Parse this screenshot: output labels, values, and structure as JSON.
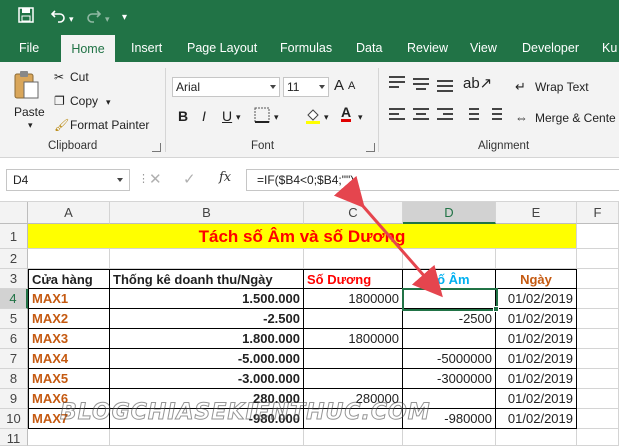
{
  "colors": {
    "ribbon_green": "#217346",
    "title_fill": "#ffff00",
    "title_text": "#ff0000",
    "store_text": "#c55a11",
    "am_header": "#00b0f0",
    "arrow": "#e5454e"
  },
  "tabs": [
    "File",
    "Home",
    "Insert",
    "Page Layout",
    "Formulas",
    "Data",
    "Review",
    "View",
    "Developer",
    "Ku"
  ],
  "active_tab": "Home",
  "clipboard": {
    "paste": "Paste",
    "cut": "Cut",
    "copy": "Copy",
    "format_painter": "Format Painter",
    "label": "Clipboard"
  },
  "font": {
    "name": "Arial",
    "size": "11",
    "bold": "B",
    "italic": "I",
    "underline": "U",
    "label": "Font",
    "grow": "A",
    "shrink": "A"
  },
  "alignment": {
    "wrap_text": "Wrap Text",
    "merge": "Merge & Cente",
    "label": "Alignment"
  },
  "formula_bar": {
    "name_box": "D4",
    "fx": "fx",
    "formula": "=IF($B4<0;$B4;\"\")"
  },
  "columns": [
    "A",
    "B",
    "C",
    "D",
    "E",
    "F"
  ],
  "rows": [
    "1",
    "2",
    "3",
    "4",
    "5",
    "6",
    "7",
    "8",
    "9",
    "10",
    "11"
  ],
  "sheet": {
    "title": "Tách số Âm và số Dương",
    "headers": {
      "store": "Cửa hàng",
      "stats": "Thống kê doanh thu/Ngày",
      "positive": "Số Dương",
      "negative": "Số Âm",
      "date": "Ngày"
    },
    "data": [
      {
        "store": "MAX1",
        "value": "1.500.000",
        "positive": "1800000",
        "negative": "",
        "date": "01/02/2019"
      },
      {
        "store": "MAX2",
        "value": "-2.500",
        "positive": "",
        "negative": "-2500",
        "date": "01/02/2019"
      },
      {
        "store": "MAX3",
        "value": "1.800.000",
        "positive": "1800000",
        "negative": "",
        "date": "01/02/2019"
      },
      {
        "store": "MAX4",
        "value": "-5.000.000",
        "positive": "",
        "negative": "-5000000",
        "date": "01/02/2019"
      },
      {
        "store": "MAX5",
        "value": "-3.000.000",
        "positive": "",
        "negative": "-3000000",
        "date": "01/02/2019"
      },
      {
        "store": "MAX6",
        "value": "280.000",
        "positive": "280000",
        "negative": "",
        "date": "01/02/2019"
      },
      {
        "store": "MAX7",
        "value": "-980.000",
        "positive": "",
        "negative": "-980000",
        "date": "01/02/2019"
      }
    ]
  },
  "watermark": "BLOGCHIASEKIENTHUC.COM"
}
